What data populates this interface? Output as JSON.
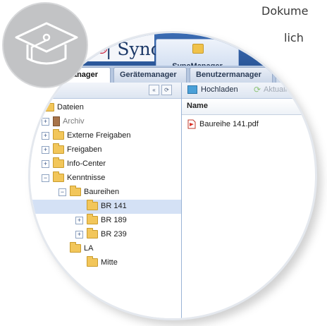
{
  "caption": {
    "line1": "Dokume",
    "line2": "lich"
  },
  "brand": {
    "suffix": "c®",
    "sync": "| Sync"
  },
  "app_tab": {
    "label": "SyncManager",
    "close": "×"
  },
  "subtabs": [
    {
      "label": "eimanager",
      "active": true
    },
    {
      "label": "Gerätemanager",
      "active": false
    },
    {
      "label": "Benutzermanager",
      "active": false
    },
    {
      "label": "S",
      "active": false
    }
  ],
  "left_toolbar": {
    "collapse": "«",
    "refresh": "⟳"
  },
  "tree": [
    {
      "label": "Dateien",
      "toggle": "−"
    },
    {
      "label": "Archiv",
      "toggle": "+"
    },
    {
      "label": "Externe Freigaben",
      "toggle": "+"
    },
    {
      "label": "Freigaben",
      "toggle": "+"
    },
    {
      "label": "Info-Center",
      "toggle": "+"
    },
    {
      "label": "Kenntnisse",
      "toggle": "−"
    },
    {
      "label": "Baureihen",
      "toggle": "−"
    },
    {
      "label": "BR 141",
      "toggle": "",
      "selected": true
    },
    {
      "label": "BR 189",
      "toggle": "+"
    },
    {
      "label": "BR 239",
      "toggle": "+"
    },
    {
      "label": "LA",
      "toggle": ""
    },
    {
      "label": "Mitte",
      "toggle": ""
    }
  ],
  "right_toolbar": {
    "upload": "Hochladen",
    "refresh": "Aktualisieren"
  },
  "file_list": {
    "column_name": "Name",
    "files": [
      "Baureihe 141.pdf"
    ]
  },
  "colors": {
    "banner": "#2a5697",
    "selection": "#d4e1f5",
    "folder": "#f2c65a",
    "badge": "#c2c3c5"
  }
}
